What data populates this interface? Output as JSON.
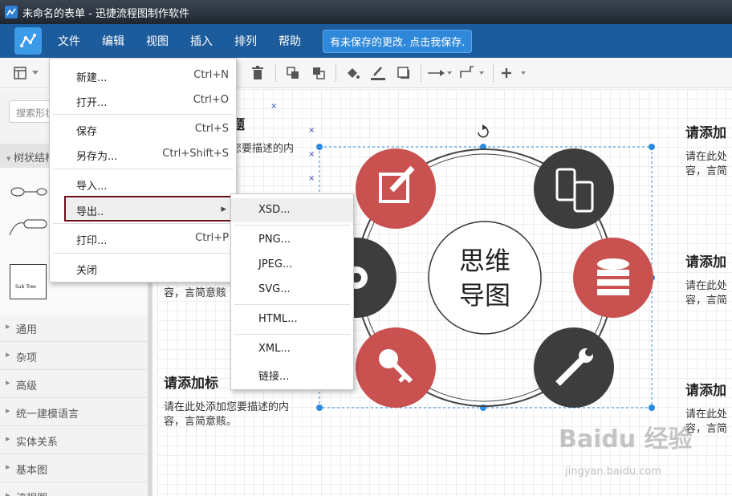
{
  "window": {
    "title": "未命名的表单 - 迅捷流程图制作软件"
  },
  "menubar": {
    "items": [
      "文件",
      "编辑",
      "视图",
      "插入",
      "排列",
      "帮助"
    ],
    "unsaved_notice": "有未保存的更改. 点击我保存."
  },
  "left_panel": {
    "search_placeholder": "搜索形状",
    "tree_section": "树状结构",
    "shape_label": "Sub Tree",
    "categories": [
      "通用",
      "杂项",
      "高级",
      "统一建模语言",
      "实体关系",
      "基本图",
      "流程图"
    ]
  },
  "file_menu": {
    "items": [
      {
        "label": "新建...",
        "shortcut": "Ctrl+N"
      },
      {
        "label": "打开...",
        "shortcut": "Ctrl+O"
      },
      {
        "label": "保存",
        "shortcut": "Ctrl+S"
      },
      {
        "label": "另存为...",
        "shortcut": "Ctrl+Shift+S"
      },
      {
        "label": "导入...",
        "shortcut": ""
      },
      {
        "label": "导出..",
        "shortcut": "▸"
      },
      {
        "label": "打印...",
        "shortcut": "Ctrl+P"
      },
      {
        "label": "关闭",
        "shortcut": ""
      }
    ]
  },
  "export_submenu": {
    "items": [
      "XSD...",
      "PNG...",
      "JPEG...",
      "SVG...",
      "HTML...",
      "XML...",
      "链接..."
    ]
  },
  "canvas": {
    "center_label_line1": "思维",
    "center_label_line2": "导图",
    "left_title_top": "题",
    "left_body_top_1": "您要描述的内",
    "left_body_top_2": "。",
    "left_body_mid": "容，言简意赅",
    "left_title_bottom": "请添加标",
    "left_body_bottom_1": "请在此处添加您要描述的内",
    "left_body_bottom_2": "容，言简意赅。",
    "right_title": "请添加",
    "right_body_1": "请在此处",
    "right_body_2": "容，言简",
    "icons": [
      "edit-icon",
      "devices-icon",
      "database-icon",
      "wrench-icon",
      "key-icon",
      "gear-icon"
    ],
    "colors": {
      "red": "#c9514f",
      "dark": "#3d3d3d",
      "selection": "#2a8adf"
    }
  },
  "watermark": {
    "main": "Baidu 经验",
    "sub": "jingyan.baidu.com"
  }
}
